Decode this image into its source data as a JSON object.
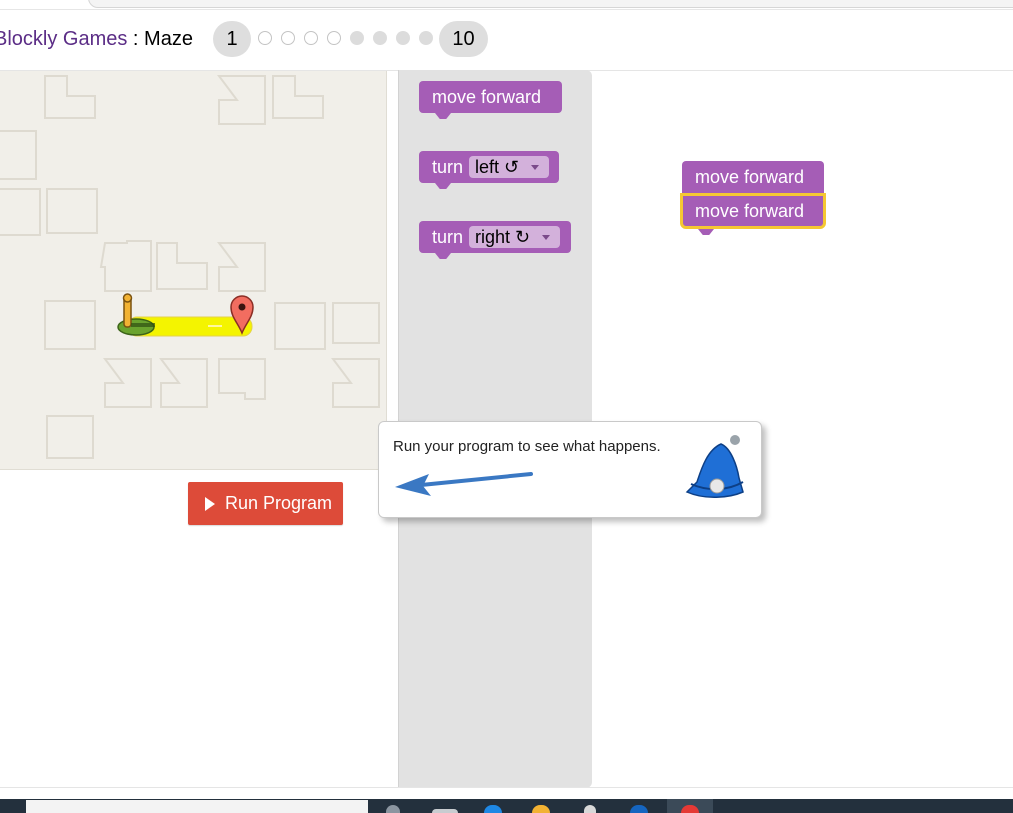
{
  "header": {
    "app_link": "Blockly Games",
    "separator": " : ",
    "game_name": "Maze",
    "level_first": "1",
    "level_last": "10",
    "levels": [
      {
        "state": "empty"
      },
      {
        "state": "empty"
      },
      {
        "state": "empty"
      },
      {
        "state": "empty"
      },
      {
        "state": "filled"
      },
      {
        "state": "filled"
      },
      {
        "state": "filled"
      },
      {
        "state": "filled"
      }
    ]
  },
  "run_button": {
    "label": "Run Program"
  },
  "toolbox": {
    "blocks": [
      {
        "label": "move forward"
      },
      {
        "label": "turn",
        "dropdown": "left ↺"
      },
      {
        "label": "turn",
        "dropdown": "right ↻"
      }
    ]
  },
  "workspace": {
    "blocks": [
      {
        "label": "move forward"
      },
      {
        "label": "move forward",
        "selected": true
      }
    ]
  },
  "dialog": {
    "message": "Run your program to see what happens.",
    "icons": [
      "arrow-left-icon",
      "bell-icon"
    ]
  },
  "colors": {
    "block_purple": "#a55db6",
    "run_button_red": "#dd4b39",
    "selection_yellow": "#f5c732",
    "path_yellow": "#f4f400",
    "arrow_blue": "#3a78c3"
  }
}
